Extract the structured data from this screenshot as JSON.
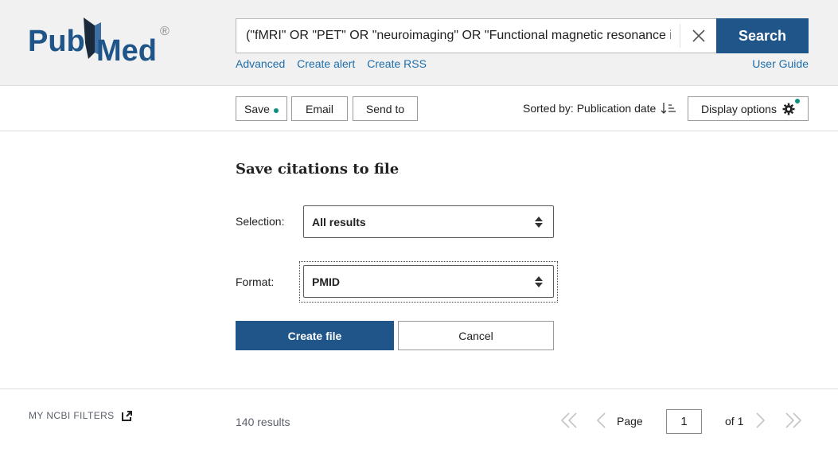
{
  "header": {
    "logo_text": "PubMed",
    "logo_reg": "®",
    "search_value": "(\"fMRI\" OR \"PET\" OR \"neuroimaging\" OR \"Functional magnetic resonance ima",
    "search_button": "Search",
    "links": [
      "Advanced",
      "Create alert",
      "Create RSS"
    ],
    "user_guide": "User Guide"
  },
  "toolbar": {
    "save": "Save",
    "email": "Email",
    "send_to": "Send to",
    "sorted_by": "Sorted by: Publication date",
    "display_options": "Display options"
  },
  "save_panel": {
    "title": "Save citations to file",
    "selection_label": "Selection:",
    "selection_value": "All results",
    "format_label": "Format:",
    "format_value": "PMID",
    "create_button": "Create file",
    "cancel_button": "Cancel"
  },
  "footer": {
    "ncbi_filters": "MY NCBI FILTERS",
    "results_count": "140 results",
    "page_label": "Page",
    "page_value": "1",
    "of_label": "of 1"
  },
  "colors": {
    "brand_blue": "#20558a",
    "link_blue": "#1f6ea9",
    "accent_green": "#0c8f7d",
    "header_bg": "#f1f1f1"
  },
  "icons": [
    "clear-icon",
    "sort-icon",
    "gear-icon",
    "select-arrows-icon",
    "external-link-icon",
    "first-page-icon",
    "prev-page-icon",
    "next-page-icon",
    "last-page-icon"
  ]
}
